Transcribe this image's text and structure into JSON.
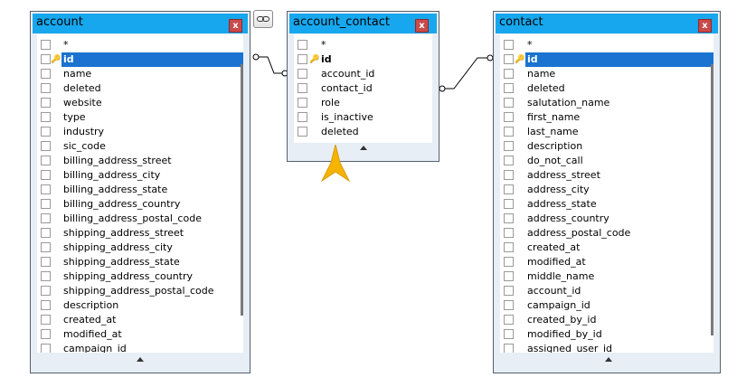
{
  "tables": {
    "account": {
      "title": "account",
      "close_label": "x",
      "columns": [
        "*",
        "id",
        "name",
        "deleted",
        "website",
        "type",
        "industry",
        "sic_code",
        "billing_address_street",
        "billing_address_city",
        "billing_address_state",
        "billing_address_country",
        "billing_address_postal_code",
        "shipping_address_street",
        "shipping_address_city",
        "shipping_address_state",
        "shipping_address_country",
        "shipping_address_postal_code",
        "description",
        "created_at",
        "modified_at",
        "campaign_id"
      ]
    },
    "account_contact": {
      "title": "account_contact",
      "close_label": "x",
      "columns": [
        "*",
        "id",
        "account_id",
        "contact_id",
        "role",
        "is_inactive",
        "deleted"
      ]
    },
    "contact": {
      "title": "contact",
      "close_label": "x",
      "columns": [
        "*",
        "id",
        "name",
        "deleted",
        "salutation_name",
        "first_name",
        "last_name",
        "description",
        "do_not_call",
        "address_street",
        "address_city",
        "address_state",
        "address_country",
        "address_postal_code",
        "created_at",
        "modified_at",
        "middle_name",
        "account_id",
        "campaign_id",
        "created_by_id",
        "modified_by_id",
        "assigned_user_id"
      ]
    }
  },
  "icons": {
    "link_button": "link-icon",
    "key": "key-icon",
    "pointer": "star-pointer-icon"
  },
  "colors": {
    "title_bar": "#16a7ee",
    "selection": "#1a73d0",
    "close": "#c94a4a",
    "pointer": "#f5b400"
  }
}
